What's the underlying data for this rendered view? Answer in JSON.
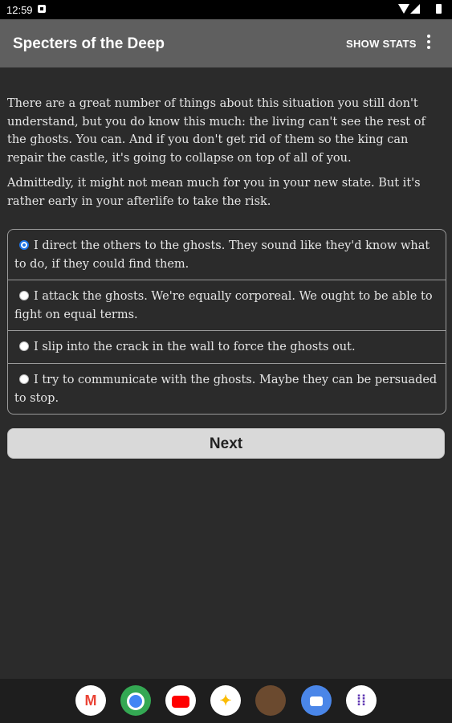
{
  "status_bar": {
    "time": "12:59"
  },
  "app_bar": {
    "title": "Specters of the Deep",
    "show_stats_label": "SHOW STATS"
  },
  "story": {
    "paragraphs": [
      "There are a great number of things about this situation you still don't understand, but you do know this much: the living can't see the rest of the ghosts. You can. And if you don't get rid of them so the king can repair the castle, it's going to collapse on top of all of you.",
      "Admittedly, it might not mean much for you in your new state. But it's rather early in your afterlife to take the risk."
    ]
  },
  "choices": [
    {
      "label": "I direct the others to the ghosts. They sound like they'd know what to do, if they could find them.",
      "selected": true
    },
    {
      "label": "I attack the ghosts. We're equally corporeal. We ought to be able to fight on equal terms.",
      "selected": false
    },
    {
      "label": "I slip into the crack in the wall to force the ghosts out.",
      "selected": false
    },
    {
      "label": "I try to communicate with the ghosts. Maybe they can be persuaded to stop.",
      "selected": false
    }
  ],
  "next_label": "Next",
  "dock": {
    "apps": [
      {
        "icon": "gmail-icon",
        "color": "#ea4335"
      },
      {
        "icon": "chrome-icon",
        "color": "#34a853"
      },
      {
        "icon": "youtube-icon",
        "color": "#ff0000"
      },
      {
        "icon": "photos-icon",
        "color": "#fbbc04"
      },
      {
        "icon": "game-app-icon",
        "color": "#6b4a2f"
      },
      {
        "icon": "messages-icon",
        "color": "#1a73e8"
      },
      {
        "icon": "app-drawer-icon",
        "color": "#5e35b1"
      }
    ]
  }
}
